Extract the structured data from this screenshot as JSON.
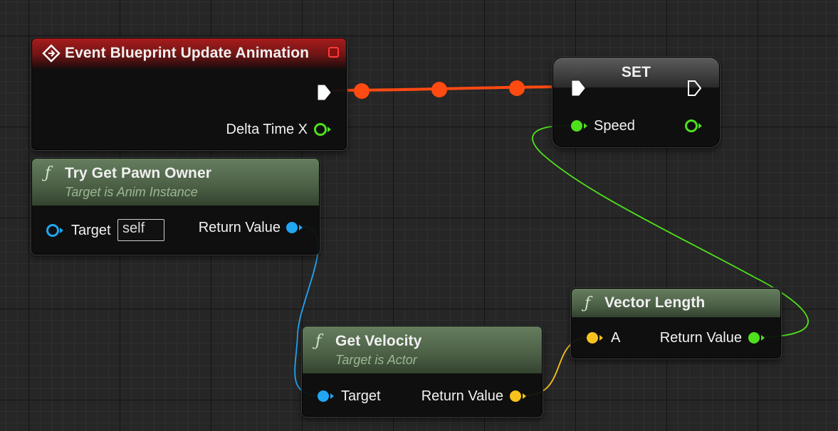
{
  "colors": {
    "exec": "#ffffff",
    "exec_wire": "#ff4a12",
    "float": "#4ee01c",
    "object": "#21a6f2",
    "vector": "#f8c21d",
    "event_header": "#a81c1c",
    "function_header": "#667d5e",
    "set_header": "#5c5c5c"
  },
  "event_node": {
    "title": "Event Blueprint Update Animation",
    "icon": "event-diamond-icon",
    "output_pin": "Delta Time X"
  },
  "set_node": {
    "title": "SET",
    "input_pin": "Speed"
  },
  "try_get_pawn_owner": {
    "title": "Try Get Pawn Owner",
    "subtitle": "Target is Anim Instance",
    "input_pin": "Target",
    "input_value": "self",
    "output_pin": "Return Value"
  },
  "get_velocity": {
    "title": "Get Velocity",
    "subtitle": "Target is Actor",
    "input_pin": "Target",
    "output_pin": "Return Value"
  },
  "vector_length": {
    "title": "Vector Length",
    "input_pin": "A",
    "output_pin": "Return Value"
  }
}
